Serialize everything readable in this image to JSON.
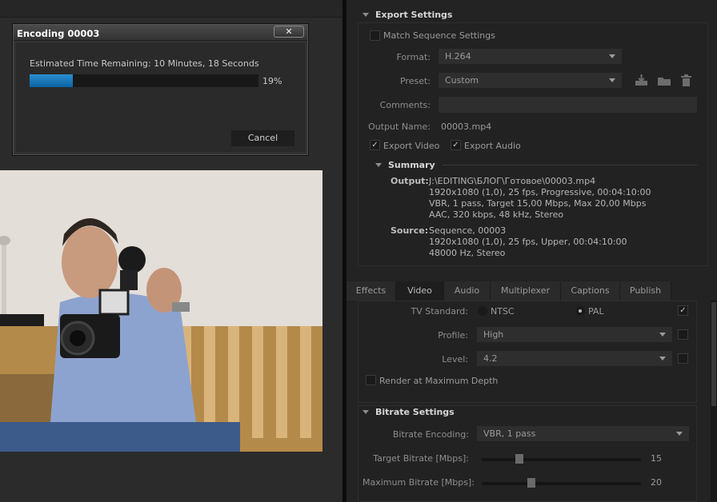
{
  "dialog": {
    "title": "Encoding 00003",
    "close_glyph": "✕",
    "estimate": "Estimated Time Remaining: 10 Minutes, 18 Seconds",
    "progress_fraction": 0.19,
    "progress_text": "19%",
    "cancel_label": "Cancel"
  },
  "export": {
    "header": "Export Settings",
    "match_sequence": "Match Sequence Settings",
    "format_label": "Format:",
    "format_value": "H.264",
    "preset_label": "Preset:",
    "preset_value": "Custom",
    "comments_label": "Comments:",
    "output_name_label": "Output Name:",
    "output_name_value": "00003.mp4",
    "export_video": "Export Video",
    "export_audio": "Export Audio"
  },
  "summary": {
    "header": "Summary",
    "output_label": "Output:",
    "output_lines": [
      "J:\\EDITING\\БЛОГ\\Готовое\\00003.mp4",
      "1920x1080 (1,0), 25 fps, Progressive, 00:04:10:00",
      "VBR, 1 pass, Target 15,00 Mbps, Max 20,00 Mbps",
      "AAC, 320 kbps, 48 kHz, Stereo"
    ],
    "source_label": "Source:",
    "source_lines": [
      "Sequence, 00003",
      "1920x1080 (1,0), 25 fps, Upper, 00:04:10:00",
      "48000 Hz, Stereo"
    ]
  },
  "tabs": [
    "Effects",
    "Video",
    "Audio",
    "Multiplexer",
    "Captions",
    "Publish"
  ],
  "video": {
    "tv_standard_label": "TV Standard:",
    "ntsc": "NTSC",
    "pal": "PAL",
    "profile_label": "Profile:",
    "profile_value": "High",
    "level_label": "Level:",
    "level_value": "4.2",
    "render_max_depth": "Render at Maximum Depth"
  },
  "bitrate": {
    "header": "Bitrate Settings",
    "encoding_label": "Bitrate Encoding:",
    "encoding_value": "VBR, 1 pass",
    "target_label": "Target Bitrate [Mbps]:",
    "target_value": "15",
    "max_label": "Maximum Bitrate [Mbps]:",
    "max_value": "20"
  },
  "colors": {
    "accent": "#1a7bc0",
    "panel": "#232323"
  }
}
